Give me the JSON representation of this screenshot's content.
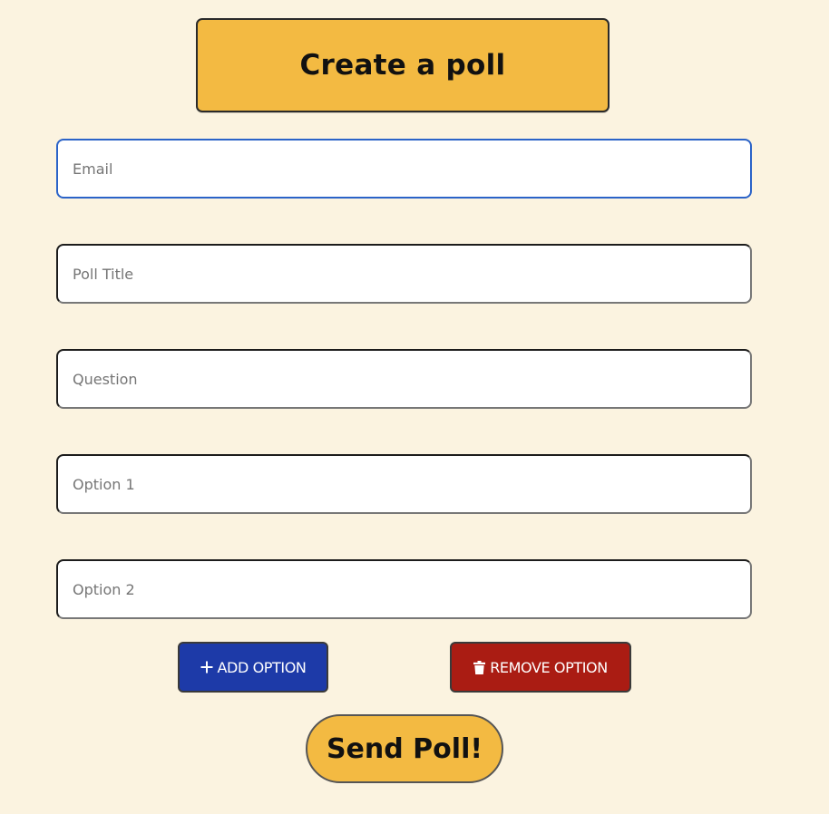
{
  "header": {
    "title": "Create a poll"
  },
  "form": {
    "email": {
      "placeholder": "Email",
      "value": ""
    },
    "poll_title": {
      "placeholder": "Poll Title",
      "value": ""
    },
    "question": {
      "placeholder": "Question",
      "value": ""
    },
    "options": [
      {
        "placeholder": "Option 1",
        "value": ""
      },
      {
        "placeholder": "Option 2",
        "value": ""
      }
    ]
  },
  "actions": {
    "add_option_label": "ADD OPTION",
    "add_option_icon": "plus-icon",
    "remove_option_label": "REMOVE OPTION",
    "remove_option_icon": "trash-icon",
    "send_label": "Send Poll!"
  },
  "colors": {
    "background": "#fbf3e0",
    "accent": "#f3ba42",
    "add_button": "#1d3aa8",
    "remove_button": "#aa1c13",
    "focus_border": "#2b63c8"
  }
}
